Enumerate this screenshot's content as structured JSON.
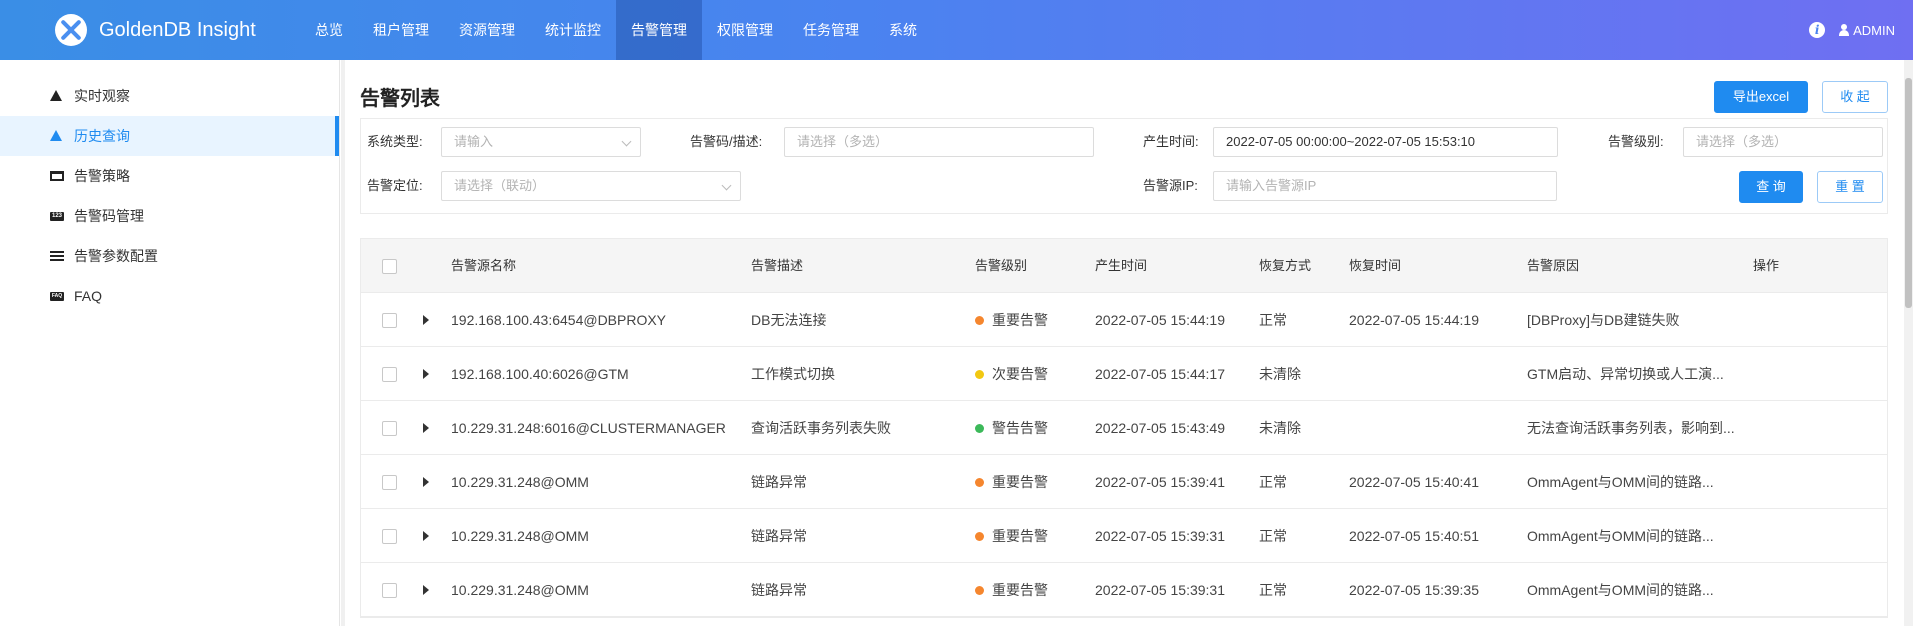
{
  "header": {
    "app_name": "GoldenDB Insight",
    "nav": [
      "总览",
      "租户管理",
      "资源管理",
      "统计监控",
      "告警管理",
      "权限管理",
      "任务管理",
      "系统"
    ],
    "active_nav_index": 4,
    "user": "ADMIN",
    "info_glyph": "i"
  },
  "sidebar": {
    "items": [
      {
        "label": "实时观察",
        "icon": "warning-icon"
      },
      {
        "label": "历史查询",
        "icon": "warning-icon",
        "active": true
      },
      {
        "label": "告警策略",
        "icon": "policy-icon"
      },
      {
        "label": "告警码管理",
        "icon": "numeric-code-icon"
      },
      {
        "label": "告警参数配置",
        "icon": "sliders-icon"
      },
      {
        "label": "FAQ",
        "icon": "faq-icon"
      }
    ],
    "num_icon_text": "123",
    "faq_icon_text": "FAQ"
  },
  "main": {
    "title": "告警列表",
    "export_label": "导出excel",
    "collapse_label": "收 起",
    "query_label": "查 询",
    "reset_label": "重 置",
    "filters": {
      "system_type": {
        "label": "系统类型:",
        "placeholder": "请输入"
      },
      "code_desc": {
        "label": "告警码/描述:",
        "placeholder": "请选择（多选）"
      },
      "time": {
        "label": "产生时间:",
        "value": "2022-07-05 00:00:00~2022-07-05 15:53:10"
      },
      "level": {
        "label": "告警级别:",
        "placeholder": "请选择（多选）"
      },
      "locate": {
        "label": "告警定位:",
        "placeholder": "请选择（联动）"
      },
      "source_ip": {
        "label": "告警源IP:",
        "placeholder": "请输入告警源IP"
      }
    },
    "table": {
      "columns": [
        "告警源名称",
        "告警描述",
        "告警级别",
        "产生时间",
        "恢复方式",
        "恢复时间",
        "告警原因",
        "操作"
      ],
      "rows": [
        {
          "source": "192.168.100.43:6454@DBPROXY",
          "desc": "DB无法连接",
          "level": "重要告警",
          "level_color": "#f5862e",
          "time": "2022-07-05 15:44:19",
          "recover": "正常",
          "recover_time": "2022-07-05 15:44:19",
          "reason": "[DBProxy]与DB建链失败"
        },
        {
          "source": "192.168.100.40:6026@GTM",
          "desc": "工作模式切换",
          "level": "次要告警",
          "level_color": "#f2c811",
          "time": "2022-07-05 15:44:17",
          "recover": "未清除",
          "recover_time": "",
          "reason": "GTM启动、异常切换或人工演..."
        },
        {
          "source": "10.229.31.248:6016@CLUSTERMANAGER",
          "desc": "查询活跃事务列表失败",
          "level": "警告告警",
          "level_color": "#3cb95a",
          "time": "2022-07-05 15:43:49",
          "recover": "未清除",
          "recover_time": "",
          "reason": "无法查询活跃事务列表，影响到..."
        },
        {
          "source": "10.229.31.248@OMM",
          "desc": "链路异常",
          "level": "重要告警",
          "level_color": "#f5862e",
          "time": "2022-07-05 15:39:41",
          "recover": "正常",
          "recover_time": "2022-07-05 15:40:41",
          "reason": "OmmAgent与OMM间的链路..."
        },
        {
          "source": "10.229.31.248@OMM",
          "desc": "链路异常",
          "level": "重要告警",
          "level_color": "#f5862e",
          "time": "2022-07-05 15:39:31",
          "recover": "正常",
          "recover_time": "2022-07-05 15:40:51",
          "reason": "OmmAgent与OMM间的链路..."
        },
        {
          "source": "10.229.31.248@OMM",
          "desc": "链路异常",
          "level": "重要告警",
          "level_color": "#f5862e",
          "time": "2022-07-05 15:39:31",
          "recover": "正常",
          "recover_time": "2022-07-05 15:39:35",
          "reason": "OmmAgent与OMM间的链路..."
        }
      ]
    }
  }
}
